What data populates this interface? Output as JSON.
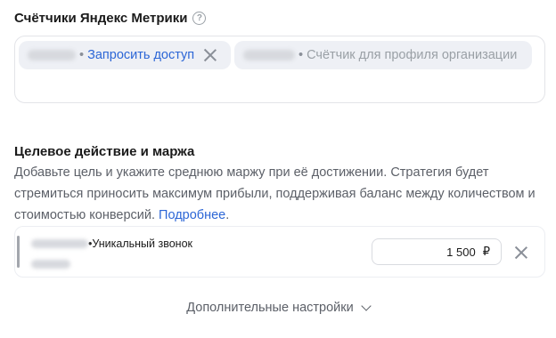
{
  "counters": {
    "title": "Счётчики Яндекс Метрики",
    "chips": [
      {
        "separator": "•",
        "label": "Запросить доступ"
      },
      {
        "separator": "•",
        "label": "Счётчик для профиля организации"
      }
    ]
  },
  "goal": {
    "title": "Целевое действие и маржа",
    "description": "Добавьте цель и укажите среднюю маржу при её достижении. Стратегия будет стремиться приносить максимум прибыли, поддерживая баланс между количеством и стоимостью конверсий.",
    "link": "Подробнее",
    "link_suffix": ".",
    "row": {
      "separator": "•",
      "label": "Уникальный звонок",
      "margin_value": "1 500",
      "currency": "₽"
    }
  },
  "more_settings_label": "Дополнительные настройки",
  "colors": {
    "link": "#2c66d6",
    "chip_bg": "#eef0f5",
    "muted_text": "#5c6068"
  }
}
